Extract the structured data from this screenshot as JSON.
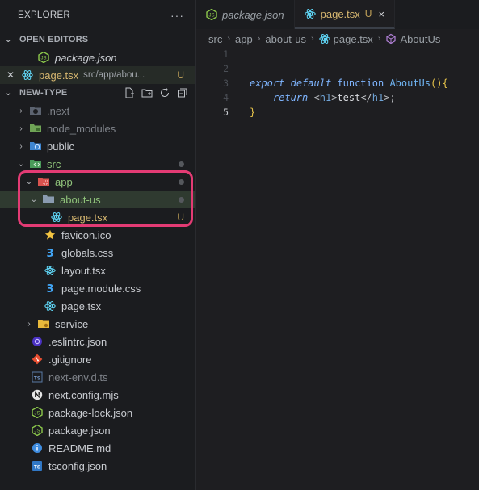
{
  "explorer": {
    "title": "EXPLORER",
    "more": "···",
    "open_editors": {
      "heading": "OPEN EDITORS",
      "items": [
        {
          "name": "package.json",
          "italic": true
        },
        {
          "name": "page.tsx",
          "path": "src/app/abou...",
          "badge": "U"
        }
      ]
    },
    "project": {
      "heading": "NEW-TYPE",
      "tree": [
        {
          "name": ".next",
          "icon": "next-folder-icon"
        },
        {
          "name": "node_modules",
          "icon": "node-modules-folder-icon"
        },
        {
          "name": "public",
          "icon": "public-folder-icon"
        },
        {
          "name": "src",
          "icon": "src-folder-icon"
        },
        {
          "name": "app",
          "icon": "app-folder-icon"
        },
        {
          "name": "about-us",
          "icon": "folder-icon"
        },
        {
          "name": "page.tsx",
          "icon": "react-icon",
          "badge": "U"
        },
        {
          "name": "favicon.ico",
          "icon": "star-icon"
        },
        {
          "name": "globals.css",
          "icon": "css-icon"
        },
        {
          "name": "layout.tsx",
          "icon": "react-icon"
        },
        {
          "name": "page.module.css",
          "icon": "css-icon"
        },
        {
          "name": "page.tsx",
          "icon": "react-icon"
        },
        {
          "name": "service",
          "icon": "service-folder-icon"
        },
        {
          "name": ".eslintrc.json",
          "icon": "eslint-icon"
        },
        {
          "name": ".gitignore",
          "icon": "git-icon"
        },
        {
          "name": "next-env.d.ts",
          "icon": "ts-icon"
        },
        {
          "name": "next.config.mjs",
          "icon": "next-icon"
        },
        {
          "name": "package-lock.json",
          "icon": "nodejs-icon"
        },
        {
          "name": "package.json",
          "icon": "nodejs-icon"
        },
        {
          "name": "README.md",
          "icon": "info-icon"
        },
        {
          "name": "tsconfig.json",
          "icon": "tsconfig-icon"
        }
      ]
    }
  },
  "tabs": [
    {
      "name": "package.json"
    },
    {
      "name": "page.tsx",
      "badge": "U",
      "close": "×"
    }
  ],
  "breadcrumb": [
    "src",
    "app",
    "about-us",
    "page.tsx",
    "AboutUs"
  ],
  "code": {
    "line_numbers": [
      "1",
      "2",
      "3",
      "4",
      "5"
    ],
    "tokens": {
      "export": "export",
      "default": "default",
      "function": "function",
      "name": "AboutUs",
      "paren": "()",
      "open_brace": "{",
      "return": "return",
      "lt": "<",
      "h1": "h1",
      "gt": ">",
      "text": "test",
      "close_lt": "</",
      "end": ">;",
      "close_brace": "}"
    }
  },
  "colors": {
    "accent_highlight": "#e33b74",
    "untracked": "#c6a55a",
    "react": "#61dafb"
  }
}
